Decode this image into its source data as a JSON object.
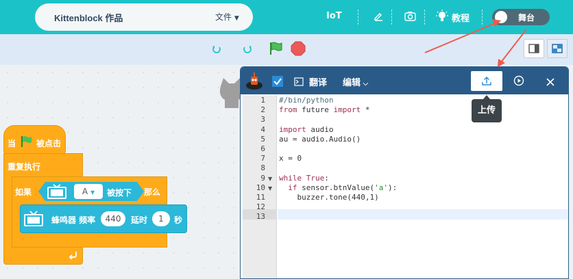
{
  "header": {
    "title": "Kittenblock 作品",
    "file_menu": "文件",
    "iot": "IoT",
    "tutorial": "教程",
    "stage": "舞台"
  },
  "blocks": {
    "when_flag": "当",
    "clicked": "被点击",
    "repeat": "重复执行",
    "if": "如果",
    "key": "A",
    "pressed": "被按下",
    "then": "那么",
    "buzzer": "蜂鸣器 频率",
    "freq": "440",
    "delay": "延时",
    "delay_val": "1",
    "seconds": "秒"
  },
  "editor": {
    "translate": "翻译",
    "edit": "编辑",
    "tooltip": "上传",
    "lines": [
      {
        "n": "1",
        "text": "#/bin/python"
      },
      {
        "n": "2",
        "text": "from future import *"
      },
      {
        "n": "3",
        "text": ""
      },
      {
        "n": "4",
        "text": "import audio"
      },
      {
        "n": "5",
        "text": "au = audio.Audio()"
      },
      {
        "n": "6",
        "text": ""
      },
      {
        "n": "7",
        "text": "x = 0"
      },
      {
        "n": "8",
        "text": ""
      },
      {
        "n": "9",
        "text": "while True:"
      },
      {
        "n": "10",
        "text": "  if sensor.btnValue('a'):"
      },
      {
        "n": "11",
        "text": "    buzzer.tone(440,1)"
      },
      {
        "n": "12",
        "text": ""
      },
      {
        "n": "13",
        "text": ""
      }
    ]
  },
  "colors": {
    "topbar": "#1bc3c8",
    "editor_header": "#2a5b88",
    "event_block": "#ffab19",
    "extension_block": "#2bb8d9",
    "annotation_arrow": "#ef5a4b"
  }
}
